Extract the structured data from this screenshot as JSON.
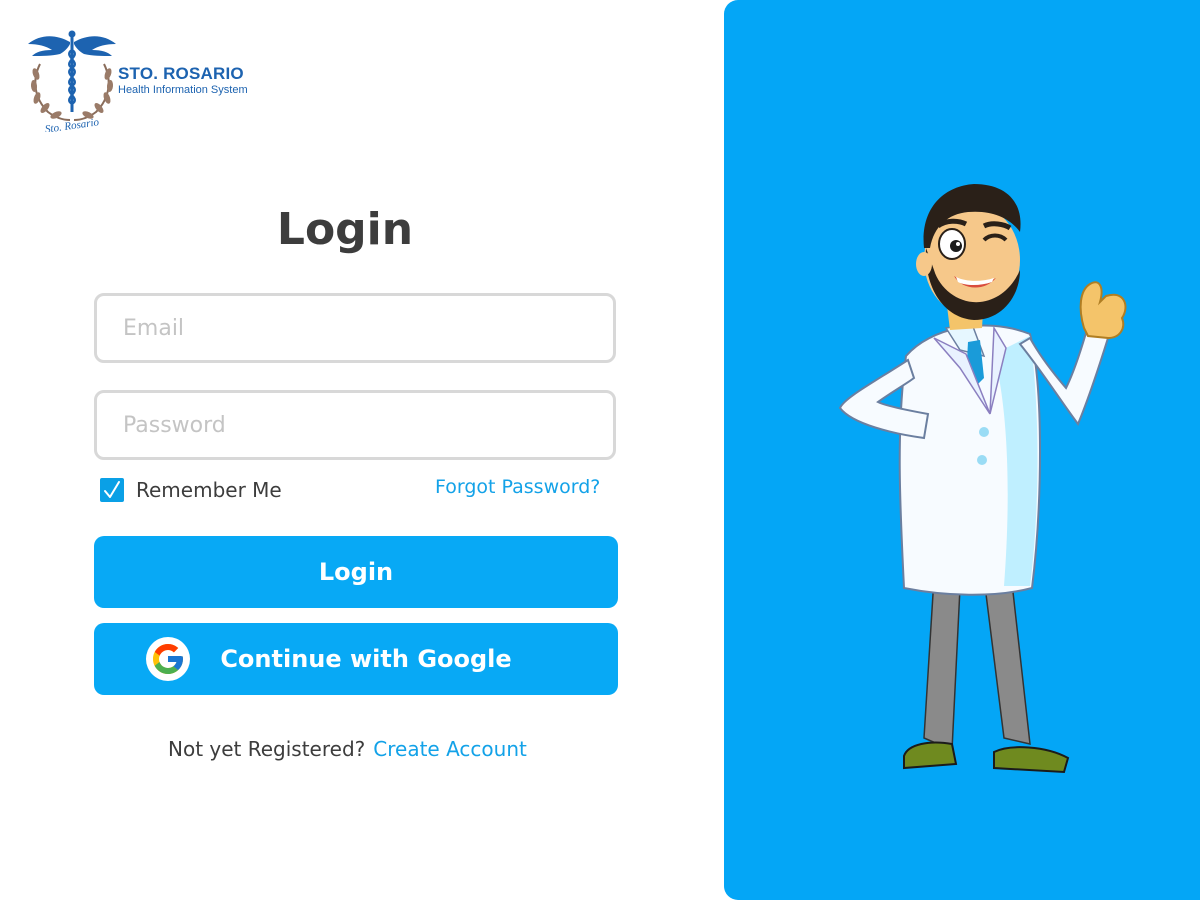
{
  "brand": {
    "name": "STO. ROSARIO",
    "subtitle": "Health Information System",
    "seal_text": "Sto. Rosario"
  },
  "form": {
    "title": "Login",
    "email_placeholder": "Email",
    "email_value": "",
    "password_placeholder": "Password",
    "password_value": "",
    "remember_label": "Remember Me",
    "remember_checked": true,
    "forgot_label": "Forgot Password?",
    "login_label": "Login",
    "google_label": "Continue with Google",
    "register_prompt": "Not yet Registered?",
    "register_link": "Create Account"
  },
  "icons": {
    "logo": "caduceus-laurel-logo",
    "checkbox": "check-icon",
    "google": "google-g-icon",
    "illustration": "doctor-thumbs-up-illustration"
  },
  "colors": {
    "primary": "#08a9f5",
    "panel": "#04a6f6",
    "link": "#13a2e8",
    "text": "#3d3d3d",
    "brand": "#1d63b0"
  }
}
